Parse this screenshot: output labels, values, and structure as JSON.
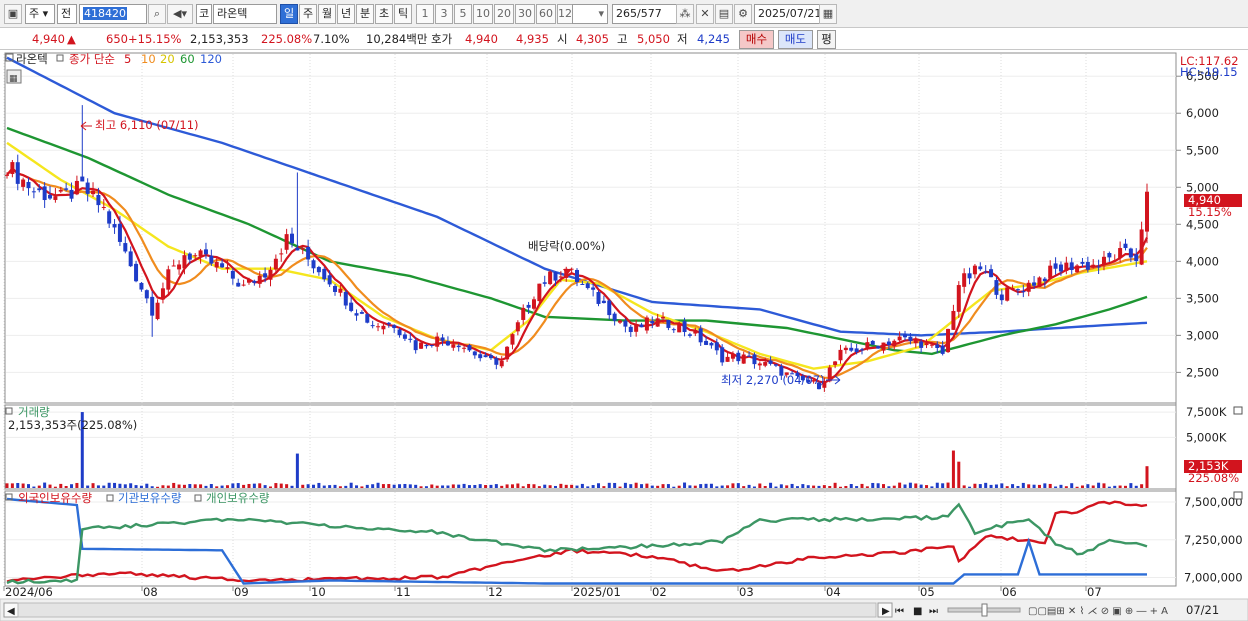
{
  "toolbar": {
    "period_mode": "주",
    "market_mode": "전",
    "code": "418420",
    "kind_label": "코",
    "stock_name": "라온텍",
    "period_buttons": [
      "일",
      "주",
      "월",
      "년",
      "분",
      "초",
      "틱"
    ],
    "active_period": "일",
    "interval_buttons": [
      "1",
      "3",
      "5",
      "10",
      "20",
      "30",
      "60",
      "120"
    ],
    "count_value": "265",
    "count_total": "/577",
    "date": "2025/07/21"
  },
  "quote": {
    "price": "4,940",
    "change": "650",
    "change_pct": "+15.15%",
    "volume": "2,153,353",
    "volume_ratio": "225.08%",
    "turnover": "7.10%",
    "amount": "10,284백만",
    "ask_label": "호가",
    "ask": "4,940",
    "bid": "4,935",
    "open_label": "시",
    "open": "4,305",
    "high_label": "고",
    "high": "5,050",
    "low_label": "저",
    "low": "4,245",
    "buy_label": "매수",
    "sell_label": "매도",
    "eval_label": "평"
  },
  "price_panel": {
    "name_tag": "라온텍",
    "legend_prefix": "종가 단순",
    "ma_periods": [
      "5",
      "10",
      "20",
      "60",
      "120"
    ],
    "lc": "LC:117.62",
    "hc": "HC:-19.15",
    "current_price_tag": "4,940",
    "current_change_tag": "15.15%",
    "max_label": "최고 6,110 (07/11)",
    "min_label": "최저 2,270 (04/07)",
    "event_label": "배당락(0.00%)"
  },
  "volume_panel": {
    "title": "거래량",
    "value": "2,153,353주(225.08%)",
    "current_tag": "2,153K",
    "current_pct": "225.08%"
  },
  "holdings_panel": {
    "series_labels": [
      "외국인보유수량",
      "기관보유수량",
      "개인보유수량"
    ]
  },
  "x_axis": {
    "labels": [
      "2024/06",
      "08",
      "09",
      "10",
      "11",
      "12",
      "2025/01",
      "02",
      "03",
      "04",
      "05",
      "06",
      "07"
    ],
    "right_label": "07/21"
  },
  "colors": {
    "up": "#d2141e",
    "down": "#1e3cc8",
    "ma5": "#d2141e",
    "ma10": "#f08c1e",
    "ma20": "#f5e61e",
    "ma60": "#1e9632",
    "ma120": "#2d5ad7",
    "foreign": "#d2141e",
    "institution": "#2d6ed7",
    "individual": "#3c9664"
  },
  "chart_data": [
    {
      "type": "candlestick",
      "panel": "price",
      "ylim": [
        2100,
        6800
      ],
      "y_ticks": [
        "6,500",
        "6,000",
        "5,500",
        "5,000",
        "4,500",
        "4,000",
        "3,500",
        "3,000",
        "2,500"
      ],
      "x_ticks": [
        "2024/06",
        "08",
        "09",
        "10",
        "11",
        "12",
        "2025/01",
        "02",
        "03",
        "04",
        "05",
        "06",
        "07"
      ],
      "close_path": [
        [
          0,
          5300
        ],
        [
          5,
          4950
        ],
        [
          10,
          4850
        ],
        [
          14,
          5000
        ],
        [
          18,
          4700
        ],
        [
          22,
          4100
        ],
        [
          27,
          3350
        ],
        [
          30,
          3800
        ],
        [
          33,
          4100
        ],
        [
          36,
          4050
        ],
        [
          40,
          3900
        ],
        [
          44,
          3650
        ],
        [
          48,
          3850
        ],
        [
          52,
          4300
        ],
        [
          55,
          4100
        ],
        [
          60,
          3750
        ],
        [
          64,
          3400
        ],
        [
          68,
          3150
        ],
        [
          72,
          3150
        ],
        [
          76,
          2850
        ],
        [
          80,
          2950
        ],
        [
          84,
          2900
        ],
        [
          89,
          2650
        ],
        [
          92,
          2650
        ],
        [
          96,
          3300
        ],
        [
          99,
          3700
        ],
        [
          104,
          3900
        ],
        [
          108,
          3600
        ],
        [
          112,
          3350
        ],
        [
          116,
          3050
        ],
        [
          120,
          3200
        ],
        [
          124,
          3150
        ],
        [
          128,
          3000
        ],
        [
          133,
          2700
        ],
        [
          137,
          2700
        ],
        [
          142,
          2580
        ],
        [
          147,
          2400
        ],
        [
          151,
          2330
        ],
        [
          155,
          2750
        ],
        [
          160,
          2850
        ],
        [
          166,
          2950
        ],
        [
          170,
          2900
        ],
        [
          174,
          2750
        ],
        [
          177,
          3700
        ],
        [
          181,
          3900
        ],
        [
          185,
          3550
        ],
        [
          189,
          3650
        ],
        [
          194,
          3850
        ],
        [
          198,
          3950
        ],
        [
          203,
          3950
        ],
        [
          207,
          4100
        ],
        [
          210,
          4050
        ],
        [
          212,
          4940
        ]
      ],
      "ma_paths": {
        "ma20": [
          [
            0,
            5600
          ],
          [
            10,
            5100
          ],
          [
            20,
            4700
          ],
          [
            30,
            4200
          ],
          [
            40,
            3900
          ],
          [
            50,
            3900
          ],
          [
            60,
            3750
          ],
          [
            70,
            3250
          ],
          [
            80,
            2950
          ],
          [
            90,
            2800
          ],
          [
            97,
            3200
          ],
          [
            103,
            3750
          ],
          [
            110,
            3700
          ],
          [
            120,
            3300
          ],
          [
            130,
            3050
          ],
          [
            140,
            2750
          ],
          [
            150,
            2550
          ],
          [
            160,
            2650
          ],
          [
            170,
            2850
          ],
          [
            176,
            3200
          ],
          [
            183,
            3600
          ],
          [
            192,
            3700
          ],
          [
            200,
            3850
          ],
          [
            212,
            4000
          ]
        ],
        "ma60": [
          [
            0,
            5800
          ],
          [
            15,
            5400
          ],
          [
            30,
            4900
          ],
          [
            45,
            4500
          ],
          [
            60,
            4000
          ],
          [
            75,
            3800
          ],
          [
            90,
            3500
          ],
          [
            100,
            3250
          ],
          [
            115,
            3200
          ],
          [
            130,
            3200
          ],
          [
            145,
            3100
          ],
          [
            155,
            2950
          ],
          [
            165,
            2800
          ],
          [
            172,
            2750
          ],
          [
            185,
            3000
          ],
          [
            195,
            3150
          ],
          [
            205,
            3350
          ],
          [
            212,
            3520
          ]
        ],
        "ma120": [
          [
            0,
            6750
          ],
          [
            20,
            6000
          ],
          [
            40,
            5600
          ],
          [
            60,
            5100
          ],
          [
            80,
            4600
          ],
          [
            100,
            3900
          ],
          [
            120,
            3450
          ],
          [
            140,
            3350
          ],
          [
            155,
            3050
          ],
          [
            170,
            3000
          ],
          [
            185,
            3050
          ],
          [
            200,
            3120
          ],
          [
            212,
            3170
          ]
        ]
      },
      "annotations": [
        {
          "label": "최고 6,110 (07/11)",
          "x": 14,
          "value": 6110
        },
        {
          "label": "최저 2,270 (04/07)",
          "x": 151,
          "value": 2270
        },
        {
          "label": "배당락(0.00%)",
          "x": 104,
          "value": 3850
        }
      ]
    },
    {
      "type": "bar",
      "panel": "volume",
      "ylim": [
        0,
        8000000
      ],
      "y_ticks": [
        "7,500K",
        "5,000K"
      ],
      "spikes": [
        [
          14,
          7500000
        ],
        [
          54,
          3400000
        ],
        [
          176,
          3700000
        ],
        [
          177,
          2600000
        ],
        [
          212,
          2153353
        ]
      ]
    },
    {
      "type": "line",
      "panel": "holdings",
      "ylim": [
        6950000,
        7560000
      ],
      "y_ticks": [
        "7,500,000",
        "7,250,000",
        "7,000,000"
      ],
      "series": [
        {
          "name": "외국인보유수량",
          "points": [
            [
              0,
              6980000
            ],
            [
              20,
              7030000
            ],
            [
              45,
              6980000
            ],
            [
              80,
              7000000
            ],
            [
              95,
              7110000
            ],
            [
              105,
              7180000
            ],
            [
              120,
              7140000
            ],
            [
              133,
              7040000
            ],
            [
              150,
              7130000
            ],
            [
              165,
              7160000
            ],
            [
              176,
              7210000
            ],
            [
              177,
              7100000
            ],
            [
              182,
              7280000
            ],
            [
              190,
              7240000
            ],
            [
              193,
              7220000
            ],
            [
              195,
              7430000
            ],
            [
              200,
              7440000
            ],
            [
              203,
              7500000
            ],
            [
              212,
              7480000
            ]
          ]
        },
        {
          "name": "기관보유수량",
          "points": [
            [
              0,
              7520000
            ],
            [
              13,
              7480000
            ],
            [
              14,
              7190000
            ],
            [
              40,
              7180000
            ],
            [
              44,
              6960000
            ],
            [
              60,
              6980000
            ],
            [
              100,
              6960000
            ],
            [
              150,
              6960000
            ],
            [
              176,
              6960000
            ],
            [
              178,
              7020000
            ],
            [
              188,
              7020000
            ],
            [
              190,
              7240000
            ],
            [
              192,
              7020000
            ],
            [
              212,
              7020000
            ]
          ]
        },
        {
          "name": "개인보유수량",
          "points": [
            [
              0,
              6970000
            ],
            [
              13,
              6980000
            ],
            [
              14,
              7320000
            ],
            [
              30,
              7360000
            ],
            [
              45,
              7390000
            ],
            [
              60,
              7340000
            ],
            [
              80,
              7300000
            ],
            [
              100,
              7180000
            ],
            [
              115,
              7200000
            ],
            [
              133,
              7240000
            ],
            [
              140,
              7380000
            ],
            [
              165,
              7390000
            ],
            [
              175,
              7400000
            ],
            [
              177,
              7480000
            ],
            [
              180,
              7300000
            ],
            [
              190,
              7390000
            ],
            [
              193,
              7280000
            ],
            [
              195,
              7230000
            ],
            [
              200,
              7150000
            ],
            [
              205,
              7260000
            ],
            [
              212,
              7200000
            ]
          ]
        }
      ]
    }
  ]
}
